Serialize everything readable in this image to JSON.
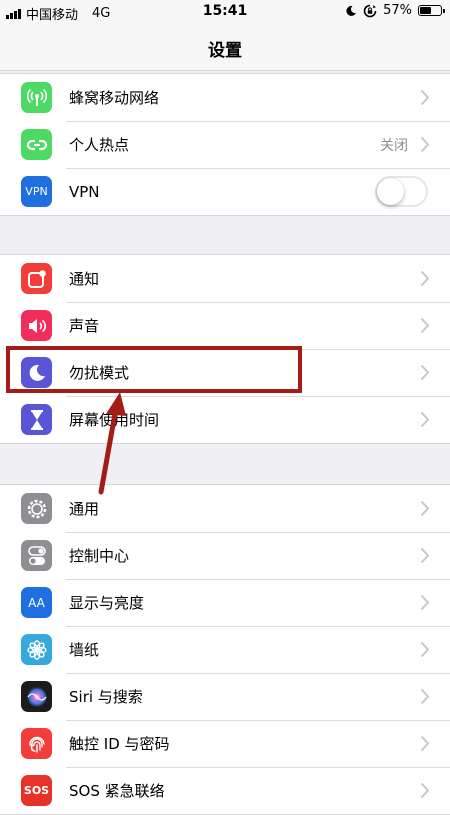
{
  "status_bar": {
    "carrier": "中国移动",
    "network": "4G",
    "time": "15:41",
    "battery": "57%",
    "battery_level": 0.57
  },
  "nav": {
    "title": "设置"
  },
  "groups": [
    {
      "items": [
        {
          "label": "蜂窝移动网络",
          "icon": "antenna-icon",
          "color": "#4cd964"
        },
        {
          "label": "个人热点",
          "icon": "hotspot-icon",
          "color": "#4cd964",
          "value": "关闭"
        },
        {
          "label": "VPN",
          "icon": "vpn-icon",
          "icon_text": "VPN",
          "color": "#1f6fe0",
          "toggle": false
        }
      ]
    },
    {
      "items": [
        {
          "label": "通知",
          "icon": "notification-icon",
          "color": "#f23d3a"
        },
        {
          "label": "声音",
          "icon": "speaker-icon",
          "color": "#f02d5b"
        },
        {
          "label": "勿扰模式",
          "icon": "moon-icon",
          "color": "#5856d6"
        },
        {
          "label": "屏幕使用时间",
          "icon": "hourglass-icon",
          "color": "#5856d6"
        }
      ]
    },
    {
      "items": [
        {
          "label": "通用",
          "icon": "gear-icon",
          "color": "#8e8e93"
        },
        {
          "label": "控制中心",
          "icon": "toggles-icon",
          "color": "#8e8e93"
        },
        {
          "label": "显示与亮度",
          "icon": "text-size-icon",
          "icon_text": "AA",
          "color": "#1f6fe0"
        },
        {
          "label": "墙纸",
          "icon": "flower-icon",
          "color": "#34aadc"
        },
        {
          "label": "Siri 与搜索",
          "icon": "siri-icon",
          "color": "#1c1c1e"
        },
        {
          "label": "触控 ID 与密码",
          "icon": "fingerprint-icon",
          "color": "#f23d3a"
        },
        {
          "label": "SOS 紧急联络",
          "icon": "sos-icon",
          "icon_text": "SOS",
          "color": "#e6332a"
        }
      ]
    }
  ],
  "annotation": {
    "color": "#a31d16"
  }
}
